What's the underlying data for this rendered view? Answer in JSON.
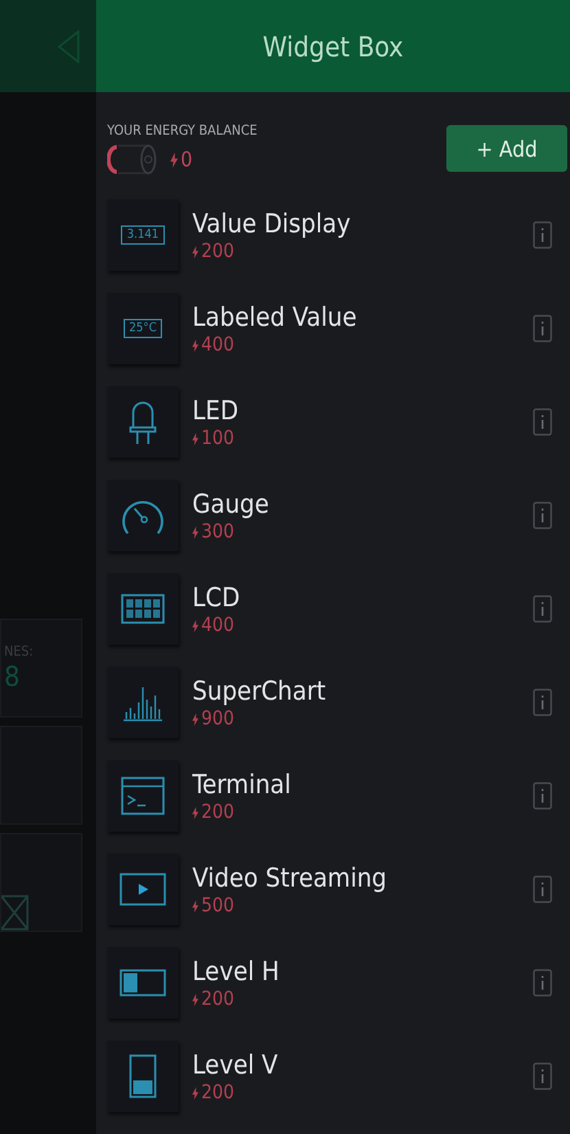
{
  "background": {
    "labels": [
      "NES:",
      "8"
    ]
  },
  "header": {
    "title": "Widget Box"
  },
  "balance": {
    "label": "YOUR ENERGY BALANCE",
    "value": "0"
  },
  "add_button": {
    "label": "+ Add"
  },
  "widgets": [
    {
      "kind": "value",
      "name": "Value Display",
      "price": "200",
      "icon_text": "3.141"
    },
    {
      "kind": "value",
      "name": "Labeled Value",
      "price": "400",
      "icon_text": "25°C"
    },
    {
      "kind": "led",
      "name": "LED",
      "price": "100"
    },
    {
      "kind": "gauge",
      "name": "Gauge",
      "price": "300"
    },
    {
      "kind": "lcd",
      "name": "LCD",
      "price": "400"
    },
    {
      "kind": "chart",
      "name": "SuperChart",
      "price": "900"
    },
    {
      "kind": "terminal",
      "name": "Terminal",
      "price": "200"
    },
    {
      "kind": "video",
      "name": "Video Streaming",
      "price": "500"
    },
    {
      "kind": "level_h",
      "name": "Level H",
      "price": "200"
    },
    {
      "kind": "level_v",
      "name": "Level V",
      "price": "200"
    }
  ]
}
